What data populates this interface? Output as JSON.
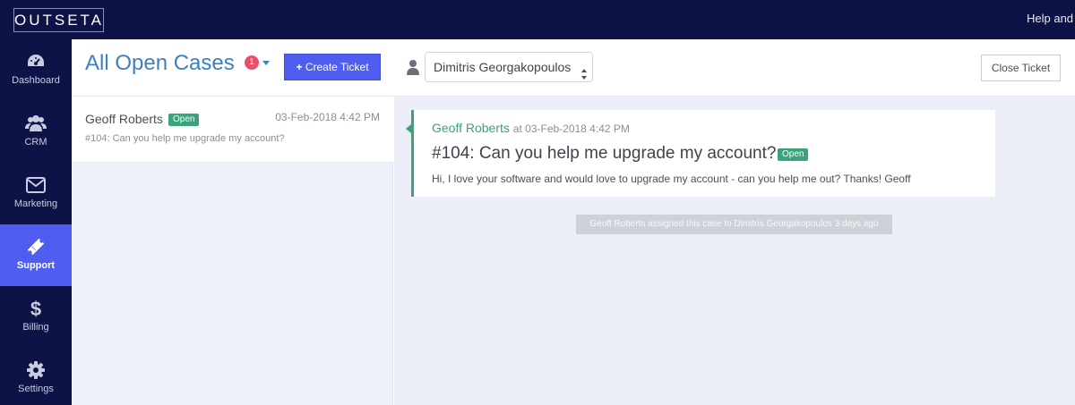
{
  "app": {
    "logo_text": "OUTSETA",
    "help_text": "Help and"
  },
  "sidebar": {
    "items": [
      {
        "label": "Dashboard",
        "icon": "dashboard-gauge-icon"
      },
      {
        "label": "CRM",
        "icon": "people-icon"
      },
      {
        "label": "Marketing",
        "icon": "envelope-icon"
      },
      {
        "label": "Support",
        "icon": "ticket-icon",
        "active": true
      },
      {
        "label": "Billing",
        "icon": "dollar-icon"
      },
      {
        "label": "Settings",
        "icon": "gear-icon"
      }
    ]
  },
  "list": {
    "title": "All Open Cases",
    "count": "1",
    "create_button": "Create Ticket",
    "tickets": [
      {
        "name": "Geoff Roberts",
        "status": "Open",
        "date": "03-Feb-2018 4:42 PM",
        "subject": "#104: Can you help me upgrade my account?"
      }
    ]
  },
  "detail": {
    "assignee": "Dimitris Georgakopoulos",
    "close_button": "Close Ticket",
    "message": {
      "author": "Geoff Roberts",
      "at": "at 03-Feb-2018 4:42 PM",
      "subject": "#104: Can you help me upgrade my account?",
      "status": "Open",
      "body": "Hi, I love your software and would love to upgrade my account - can you help me out? Thanks! Geoff"
    },
    "activity": "Geoff Roberts assigned this case to Dimitris Georgakopoulos 3 days ago"
  },
  "colors": {
    "nav_bg": "#0d1346",
    "accent": "#4f5ef0",
    "title_blue": "#3d7fc1",
    "status_green": "#3aa37a",
    "badge_red": "#e8506a"
  }
}
